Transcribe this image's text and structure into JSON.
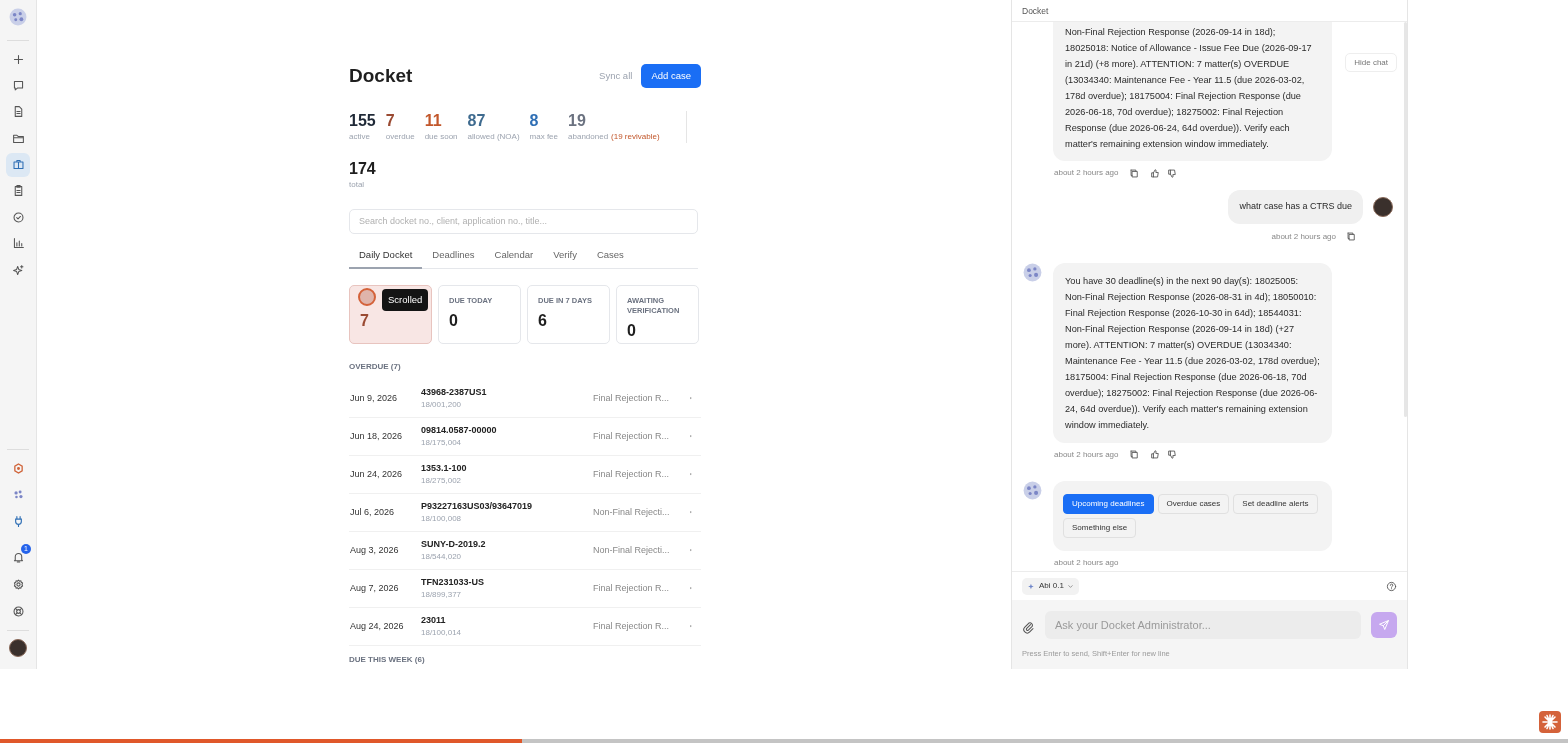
{
  "sidebar": {
    "top_items": [
      {
        "selected": false
      },
      {
        "selected": false
      },
      {
        "selected": false
      },
      {
        "selected": false
      },
      {
        "selected": true
      },
      {
        "selected": false
      },
      {
        "selected": false
      },
      {
        "selected": false
      },
      {
        "selected": false
      }
    ],
    "bottom_items": [
      {
        "selected": false
      },
      {
        "selected": false
      },
      {
        "selected": false
      },
      {
        "selected": false,
        "badge": "1"
      },
      {
        "selected": false
      },
      {
        "selected": false
      }
    ]
  },
  "docket": {
    "title": "Docket",
    "sync_button": "Sync all",
    "add_button": "Add case",
    "stats": [
      {
        "value": "155",
        "label": "active",
        "color": "#1f2937"
      },
      {
        "value": "7",
        "label": "overdue",
        "color": "#9a4a32"
      },
      {
        "value": "11",
        "label": "due soon",
        "color": "#c2572b"
      },
      {
        "value": "87",
        "label": "allowed (NOA)",
        "color": "#3f6b8f"
      },
      {
        "value": "8",
        "label": "max fee",
        "color": "#2f6fb5"
      },
      {
        "value": "19",
        "label": "abandoned",
        "note": "(19 revivable)",
        "color": "#6b7280"
      }
    ],
    "total": {
      "value": "174",
      "label": "total"
    },
    "search": {
      "placeholder": "Search docket no., client, application no., title..."
    },
    "tabs": [
      {
        "label": "Daily Docket",
        "selected": true
      },
      {
        "label": "Deadlines",
        "selected": false
      },
      {
        "label": "Calendar",
        "selected": false
      },
      {
        "label": "Verify",
        "selected": false
      },
      {
        "label": "Cases",
        "selected": false
      }
    ],
    "cards": [
      {
        "value": "7",
        "selected": true
      },
      {
        "label": "DUE TODAY",
        "value": "0",
        "selected": false
      },
      {
        "label": "DUE IN 7 DAYS",
        "value": "6",
        "selected": false
      },
      {
        "label": "AWAITING VERIFICATION",
        "value": "0",
        "selected": false
      }
    ],
    "overdue_heading": "OVERDUE (7)",
    "rows": [
      {
        "date": "Jun 9, 2026",
        "docket": "43968-2387US1",
        "application": "18/001,200",
        "type": "Final Rejection R..."
      },
      {
        "date": "Jun 18, 2026",
        "docket": "09814.0587-00000",
        "application": "18/175,004",
        "type": "Final Rejection R..."
      },
      {
        "date": "Jun 24, 2026",
        "docket": "1353.1-100",
        "application": "18/275,002",
        "type": "Final Rejection R..."
      },
      {
        "date": "Jul 6, 2026",
        "docket": "P93227163US03/93647019",
        "application": "18/100,008",
        "type": "Non-Final Rejecti..."
      },
      {
        "date": "Aug 3, 2026",
        "docket": "SUNY-D-2019.2",
        "application": "18/544,020",
        "type": "Non-Final Rejecti..."
      },
      {
        "date": "Aug 7, 2026",
        "docket": "TFN231033-US",
        "application": "18/899,377",
        "type": "Final Rejection R..."
      },
      {
        "date": "Aug 24, 2026",
        "docket": "23011",
        "application": "18/100,014",
        "type": "Final Rejection R..."
      }
    ],
    "next_heading": "DUE THIS WEEK (6)"
  },
  "chat": {
    "title": "Docket",
    "hide_button": "Hide chat",
    "messages": [
      {
        "kind": "bot",
        "cut_top": true,
        "text": "Non-Final Rejection Response (2026-09-14 in 18d); 18025018: Notice of Allowance - Issue Fee Due (2026-09-17 in 21d) (+8 more). ATTENTION: 7 matter(s) OVERDUE (13034340: Maintenance Fee - Year 11.5 (due 2026-03-02, 178d overdue); 18175004: Final Rejection Response (due 2026-06-18, 70d overdue); 18275002: Final Rejection Response (due 2026-06-24, 64d overdue)). Verify each matter's remaining extension window immediately.",
        "time": "about 2 hours ago"
      },
      {
        "kind": "user",
        "text": "whatr case has a CTRS due",
        "time": "about 2 hours ago"
      },
      {
        "kind": "bot",
        "text": "You have 30 deadline(s) in the next 90 day(s): 18025005: Non-Final Rejection Response (2026-08-31 in 4d); 18050010: Final Rejection Response (2026-10-30 in 64d); 18544031: Non-Final Rejection Response (2026-09-14 in 18d) (+27 more). ATTENTION: 7 matter(s) OVERDUE (13034340: Maintenance Fee - Year 11.5 (due 2026-03-02, 178d overdue); 18175004: Final Rejection Response (due 2026-06-18, 70d overdue); 18275002: Final Rejection Response (due 2026-06-24, 64d overdue)). Verify each matter's remaining extension window immediately.",
        "time": "about 2 hours ago"
      },
      {
        "kind": "options",
        "options": [
          {
            "label": "Upcoming deadlines",
            "selected": true
          },
          {
            "label": "Overdue cases",
            "selected": false
          },
          {
            "label": "Set deadline alerts",
            "selected": false
          },
          {
            "label": "Something else",
            "selected": false
          }
        ],
        "time": "about 2 hours ago"
      }
    ],
    "model": "Abi 0.1",
    "input": {
      "placeholder": "Ask your Docket Administrator..."
    },
    "hint": "Press Enter to send, Shift+Enter for new line"
  },
  "recording": {
    "click_tooltip": "Scrolled",
    "progress": {
      "level": 0.333
    }
  }
}
